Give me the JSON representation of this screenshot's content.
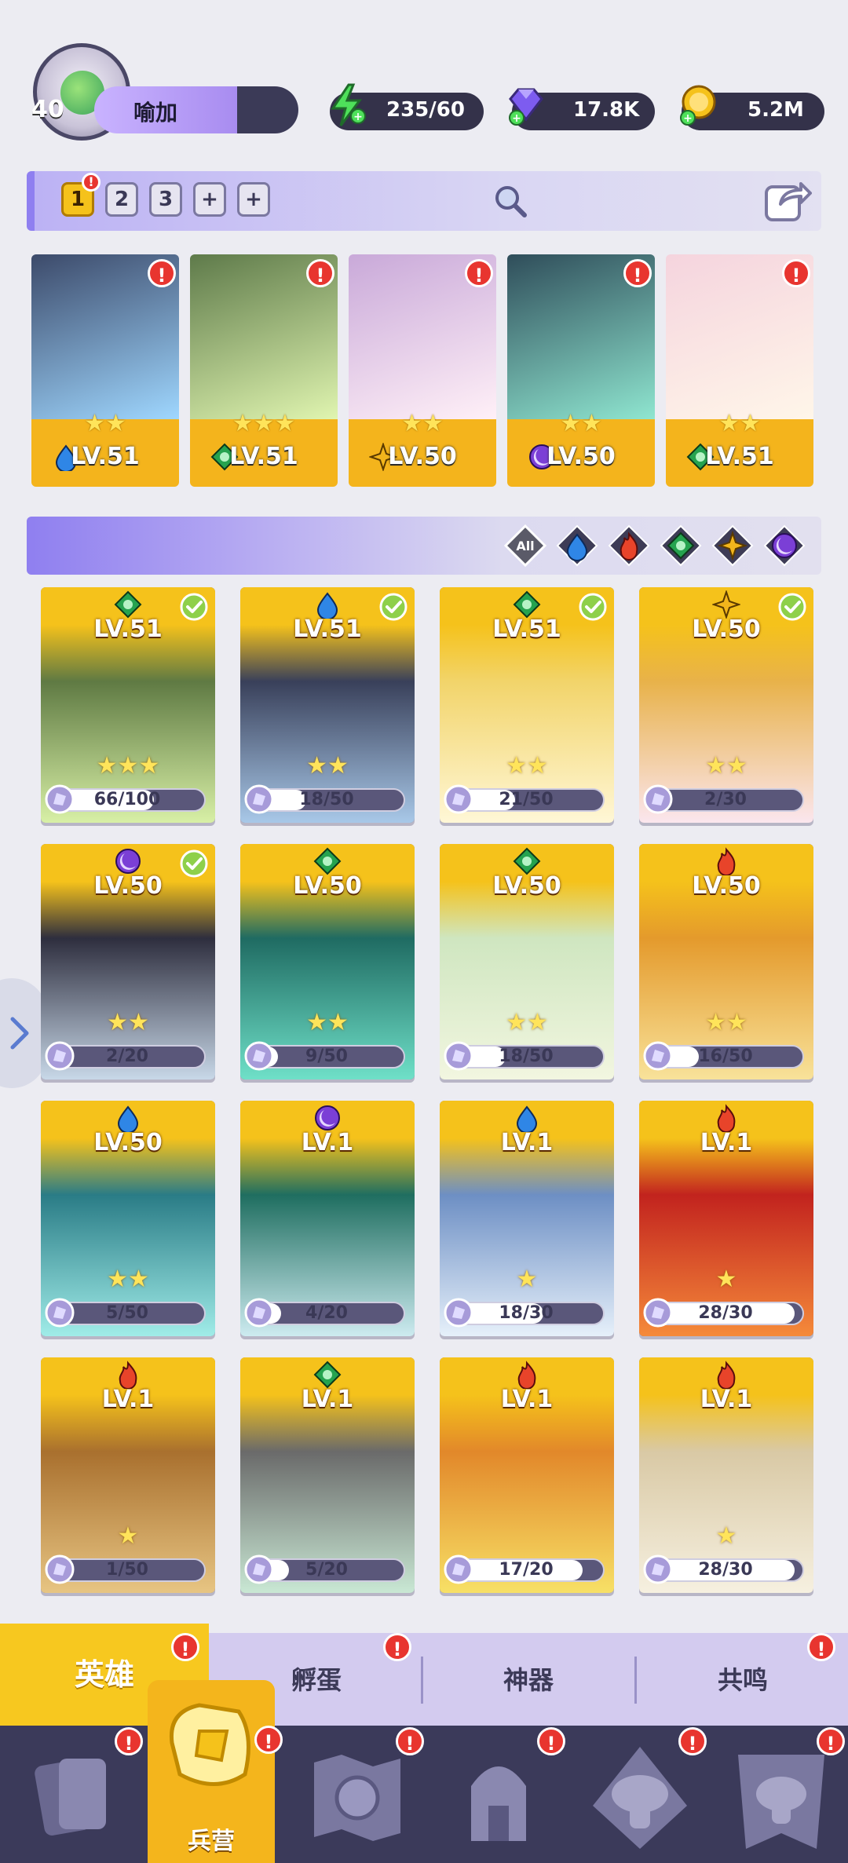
{
  "player": {
    "level": "40",
    "name": "喻加"
  },
  "resources": {
    "energy": "235/60",
    "gems": "17.8K",
    "gold": "5.2M"
  },
  "team": {
    "tabs": [
      "1",
      "2",
      "3",
      "+",
      "+"
    ],
    "cards": [
      {
        "level": "LV.51",
        "element": "water",
        "stars": "★★",
        "art": [
          "#3c4a6a",
          "#9fd7ff"
        ]
      },
      {
        "level": "LV.51",
        "element": "wind",
        "stars": "★★★",
        "art": [
          "#5e7a4a",
          "#e0f5b0"
        ]
      },
      {
        "level": "LV.50",
        "element": "light",
        "stars": "★★",
        "art": [
          "#c9a9d9",
          "#fff0f7"
        ]
      },
      {
        "level": "LV.50",
        "element": "dark",
        "stars": "★★",
        "art": [
          "#2f4d5a",
          "#8fe6d0"
        ]
      },
      {
        "level": "LV.51",
        "element": "wind",
        "stars": "★★",
        "art": [
          "#f5d4de",
          "#fff6e9"
        ]
      }
    ]
  },
  "filters": [
    "All",
    "water",
    "fire",
    "wind",
    "light",
    "dark"
  ],
  "heroes": [
    {
      "level": "LV.51",
      "element": "wind",
      "check": true,
      "stars": "★★★",
      "progress": "66/100",
      "frac": 0.66,
      "art": [
        "#5f7a43",
        "#d8f0a6"
      ]
    },
    {
      "level": "LV.51",
      "element": "water",
      "check": true,
      "stars": "★★",
      "progress": "18/50",
      "frac": 0.36,
      "art": [
        "#39405a",
        "#a8c8e8"
      ]
    },
    {
      "level": "LV.51",
      "element": "wind",
      "check": true,
      "stars": "★★",
      "progress": "21/50",
      "frac": 0.42,
      "art": [
        "#f2d46a",
        "#fff7d6"
      ]
    },
    {
      "level": "LV.50",
      "element": "light",
      "check": true,
      "stars": "★★",
      "progress": "2/30",
      "frac": 0.07,
      "art": [
        "#e8b24a",
        "#fbe6ee"
      ]
    },
    {
      "level": "LV.50",
      "element": "dark",
      "check": true,
      "stars": "★★",
      "progress": "2/20",
      "frac": 0.1,
      "art": [
        "#2e2e3e",
        "#c8d8e8"
      ]
    },
    {
      "level": "LV.50",
      "element": "wind",
      "check": false,
      "stars": "★★",
      "progress": "9/50",
      "frac": 0.18,
      "art": [
        "#1f6b62",
        "#6fe0c8"
      ]
    },
    {
      "level": "LV.50",
      "element": "wind",
      "check": false,
      "stars": "★★",
      "progress": "18/50",
      "frac": 0.36,
      "art": [
        "#cfe6c0",
        "#f2f6e0"
      ]
    },
    {
      "level": "LV.50",
      "element": "fire",
      "check": false,
      "stars": "★★",
      "progress": "16/50",
      "frac": 0.32,
      "art": [
        "#e49a2c",
        "#f8e29a"
      ]
    },
    {
      "level": "LV.50",
      "element": "water",
      "check": false,
      "stars": "★★",
      "progress": "5/50",
      "frac": 0.1,
      "art": [
        "#2a7c86",
        "#a0ece8"
      ]
    },
    {
      "level": "LV.1",
      "element": "dark",
      "check": false,
      "stars": "",
      "progress": "4/20",
      "frac": 0.2,
      "art": [
        "#1f6e60",
        "#cdebf0"
      ]
    },
    {
      "level": "LV.1",
      "element": "water",
      "check": false,
      "stars": "★",
      "progress": "18/30",
      "frac": 0.6,
      "art": [
        "#6d8fc4",
        "#e6f0fa"
      ]
    },
    {
      "level": "LV.1",
      "element": "fire",
      "check": false,
      "stars": "★",
      "progress": "28/30",
      "frac": 0.93,
      "art": [
        "#c2231e",
        "#f58a3a"
      ]
    },
    {
      "level": "LV.1",
      "element": "fire",
      "check": false,
      "stars": "★",
      "progress": "1/50",
      "frac": 0.02,
      "art": [
        "#a9702e",
        "#e7c583"
      ]
    },
    {
      "level": "LV.1",
      "element": "wind",
      "check": false,
      "stars": "",
      "progress": "5/20",
      "frac": 0.25,
      "art": [
        "#6a6a6a",
        "#c9e8d4"
      ]
    },
    {
      "level": "LV.1",
      "element": "fire",
      "check": false,
      "stars": "",
      "progress": "17/20",
      "frac": 0.85,
      "art": [
        "#e2882a",
        "#f7e066"
      ]
    },
    {
      "level": "LV.1",
      "element": "fire",
      "check": false,
      "stars": "★",
      "progress": "28/30",
      "frac": 0.93,
      "art": [
        "#d9c9a5",
        "#f6f0e0"
      ]
    }
  ],
  "subtabs": [
    "英雄",
    "孵蛋",
    "神器",
    "共鸣"
  ],
  "nav": {
    "active_label": "兵营"
  },
  "colors": {
    "water": "#2f86e6",
    "fire": "#e8442a",
    "wind": "#26a34f",
    "light": "#f2b51c",
    "dark": "#7b3fd6",
    "accent": "#f5b91c"
  }
}
